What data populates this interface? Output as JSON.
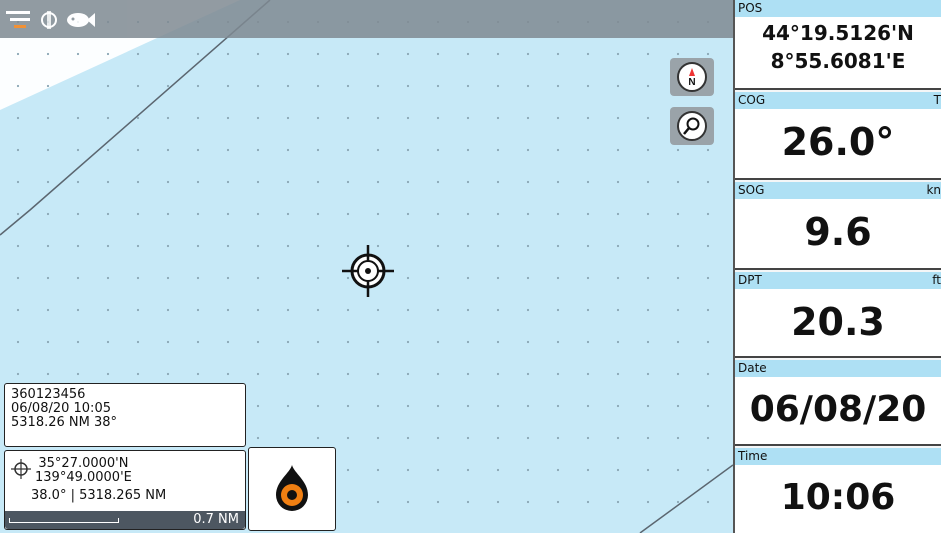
{
  "map": {
    "north_button_label": "N",
    "mob_icon": "man-overboard-icon",
    "vessel_info": {
      "mmsi": "360123456",
      "datetime": "06/08/20 10:05",
      "distance_bearing": "5318.26 NM 38°"
    },
    "cursor_info": {
      "lat": "35°27.0000'N",
      "lon": "139°49.0000'E",
      "bearing_distance": "38.0° | 5318.265 NM"
    },
    "scale_label": "0.7 NM"
  },
  "panel": {
    "pos": {
      "label": "POS",
      "lat": "44°19.5126'N",
      "lon": "8°55.6081'E"
    },
    "cog": {
      "label": "COG",
      "unit": "T",
      "value": "26.0°"
    },
    "sog": {
      "label": "SOG",
      "unit": "kn",
      "value": "9.6"
    },
    "dpt": {
      "label": "DPT",
      "unit": "ft",
      "value": "20.3"
    },
    "date": {
      "label": "Date",
      "value": "06/08/20"
    },
    "time": {
      "label": "Time",
      "value": "10:06"
    }
  },
  "colors": {
    "sea": "#c7e9f7",
    "header_bar": "#aee0f4",
    "mob_orange": "#f07f12"
  }
}
